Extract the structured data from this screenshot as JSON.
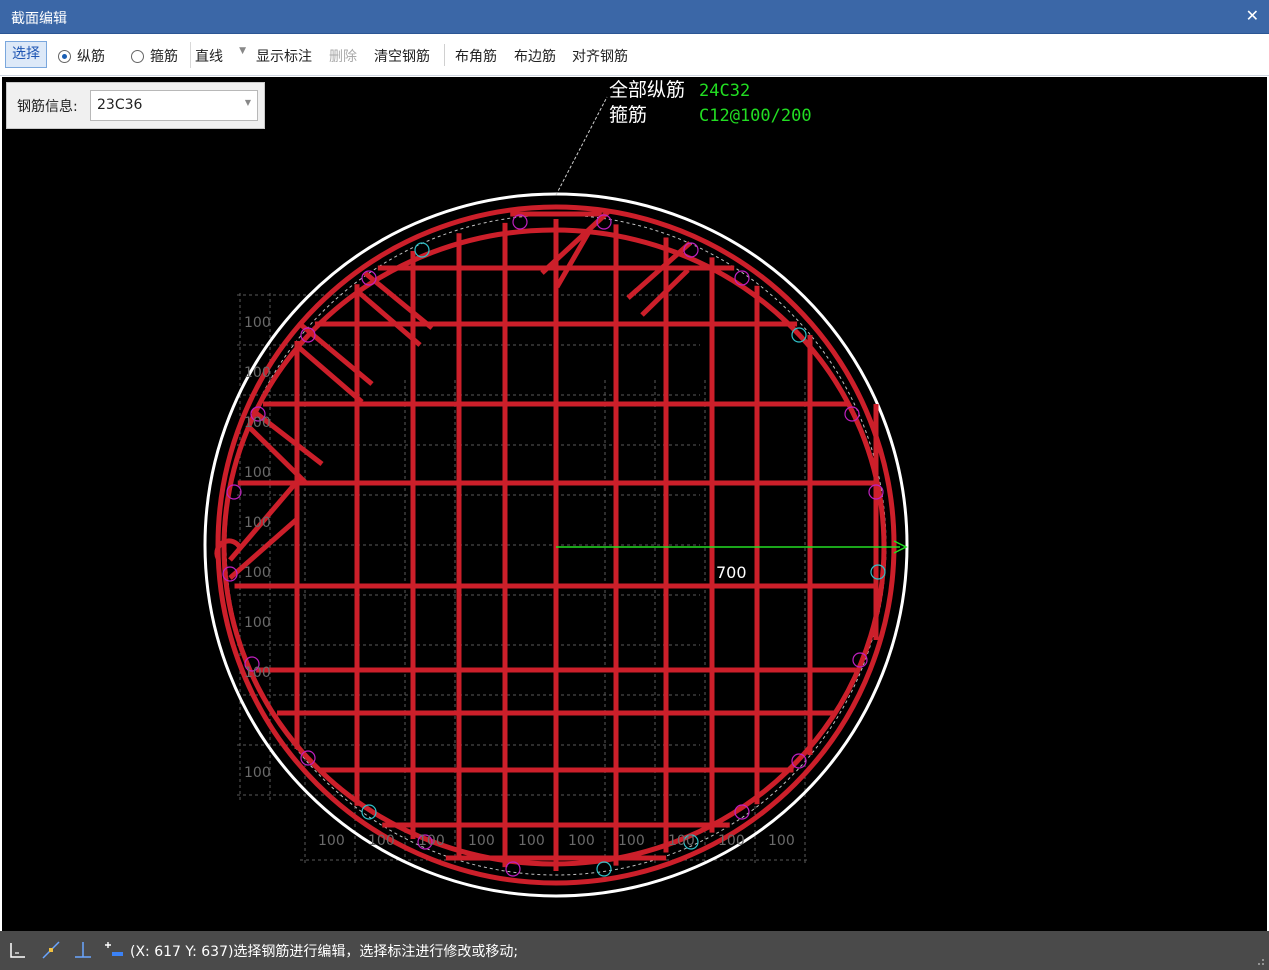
{
  "window": {
    "title": "截面编辑",
    "close_glyph": "✕"
  },
  "toolbar": {
    "select_label": "选择",
    "radio_longitudinal": "纵筋",
    "radio_stirrup": "箍筋",
    "line_mode_value": "直线",
    "show_annotation": "显示标注",
    "delete": "删除",
    "clear_rebar": "清空钢筋",
    "corner_rebar": "布角筋",
    "edge_rebar": "布边筋",
    "align_rebar": "对齐钢筋",
    "selected_radio": "纵筋"
  },
  "rebar_info": {
    "label": "钢筋信息:",
    "value": "23C36"
  },
  "drawing": {
    "label_all_longitudinal": "全部纵筋",
    "value_all_longitudinal": "24C32",
    "label_stirrup": "箍筋",
    "value_stirrup": "C12@100/200",
    "radius_dimension": "700",
    "vertical_dimension_labels": [
      "100",
      "100",
      "100",
      "100",
      "100",
      "100",
      "100",
      "100",
      "100"
    ],
    "horizontal_dimension_labels": [
      "100",
      "100",
      "100",
      "100",
      "100",
      "100",
      "100",
      "100",
      "100",
      "100"
    ],
    "colors": {
      "background": "#000000",
      "section_outline": "#ffffff",
      "rebar_red": "#cc1f2a",
      "magenta_bar": "#c020c0",
      "cyan_bar": "#30c0c8",
      "annotation_green": "#22dd22",
      "dimension_gray": "#777777"
    }
  },
  "statusbar": {
    "message": "(X: 617 Y: 637)选择钢筋进行编辑，选择标注进行修改或移动;",
    "icons": [
      "ortho-icon",
      "snap-icon",
      "perpendicular-icon",
      "polar-icon"
    ]
  }
}
